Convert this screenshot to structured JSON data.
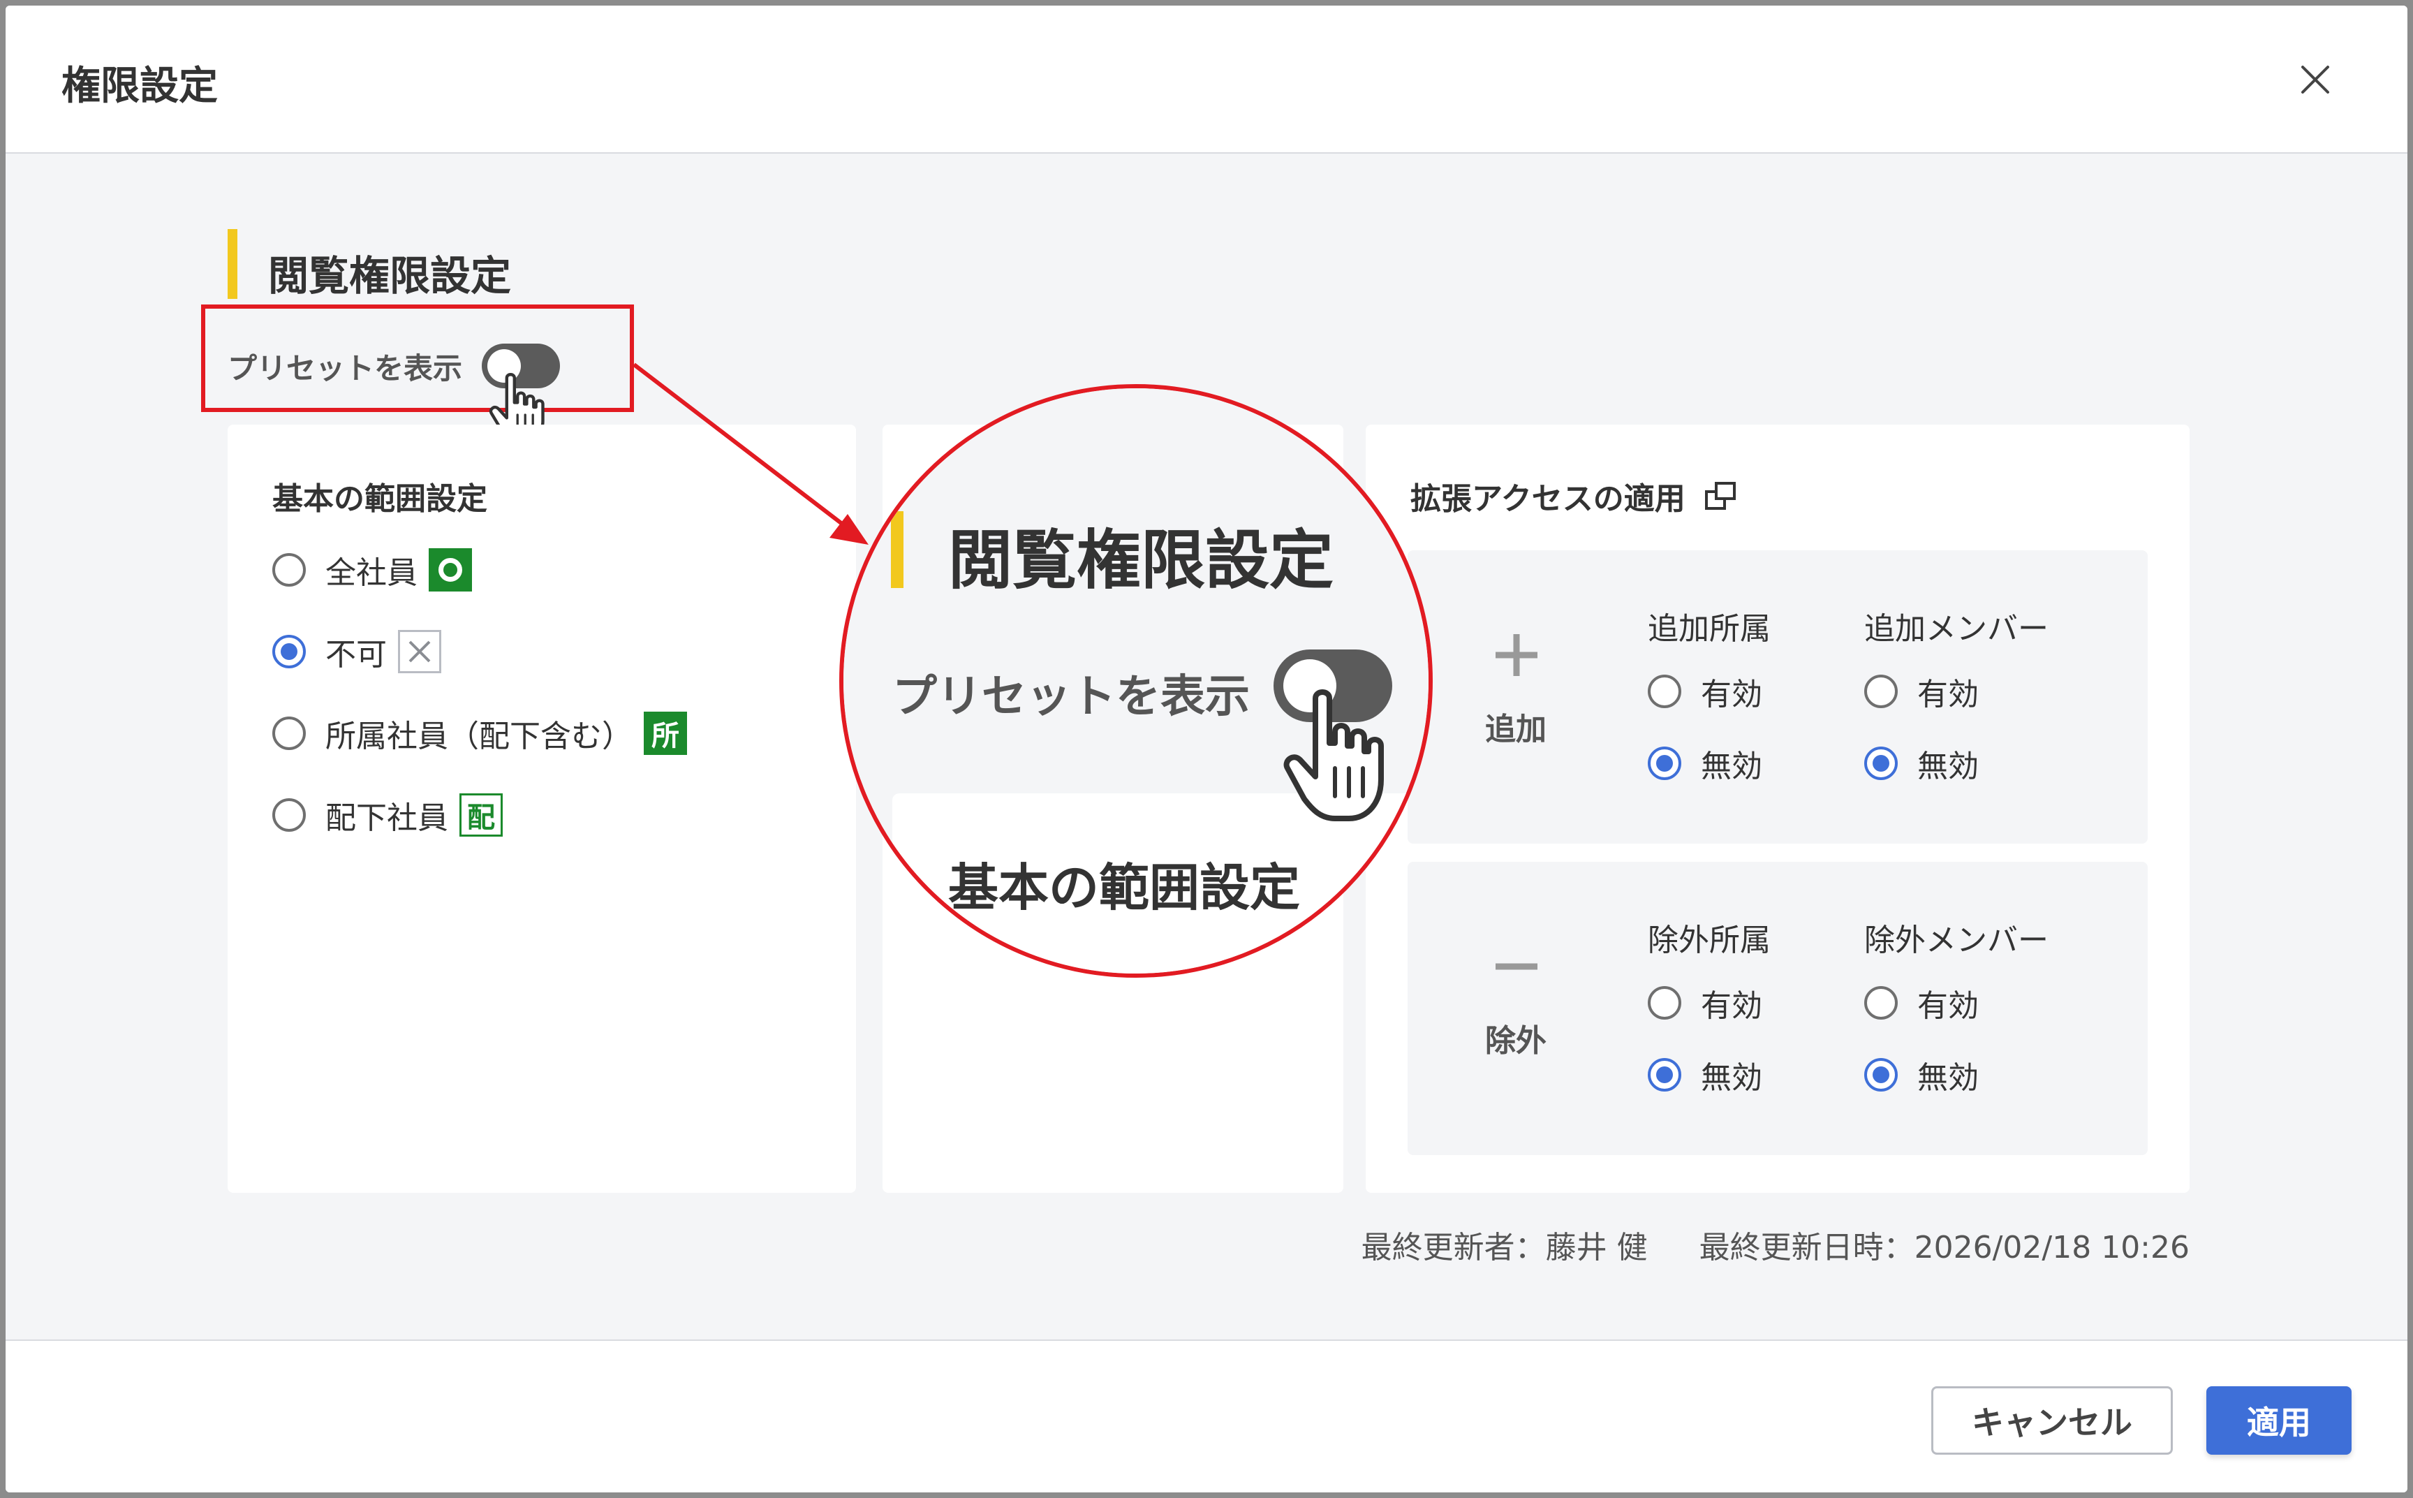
{
  "dialog": {
    "title": "権限設定",
    "close_icon": "close-icon"
  },
  "section": {
    "title": "閲覧権限設定",
    "preset_label": "プリセットを表示",
    "preset_toggle_on": false
  },
  "basic": {
    "title": "基本の範囲設定",
    "options": [
      {
        "label": "全社員",
        "checked": false,
        "badge": "circle-badge-icon"
      },
      {
        "label": "不可",
        "checked": true,
        "badge": "cross-badge-icon"
      },
      {
        "label": "所属社員（配下含む）",
        "checked": false,
        "badge_text": "所"
      },
      {
        "label": "配下社員",
        "checked": false,
        "badge_text": "配"
      }
    ]
  },
  "extended": {
    "title": "拡張アクセスの適用",
    "title_icon": "external-link-icon",
    "add": {
      "label": "追加",
      "icon": "plus-icon",
      "col1_title": "追加所属",
      "col2_title": "追加メンバー",
      "enabled_label": "有効",
      "disabled_label": "無効"
    },
    "exclude": {
      "label": "除外",
      "icon": "minus-icon",
      "col1_title": "除外所属",
      "col2_title": "除外メンバー",
      "enabled_label": "有効",
      "disabled_label": "無効"
    }
  },
  "updated": {
    "by": "最終更新者：藤井 健",
    "at": "最終更新日時：2026/02/18 10:26"
  },
  "zoom": {
    "title": "閲覧権限設定",
    "preset_label": "プリセットを表示",
    "sub_title": "基本の範囲設定"
  },
  "footer": {
    "cancel_label": "キャンセル",
    "apply_label": "適用"
  },
  "colors": {
    "accent": "#3e6fd8",
    "highlight": "#e21b22",
    "section_bar": "#f2c81e",
    "badge_green": "#1b8a2c"
  }
}
